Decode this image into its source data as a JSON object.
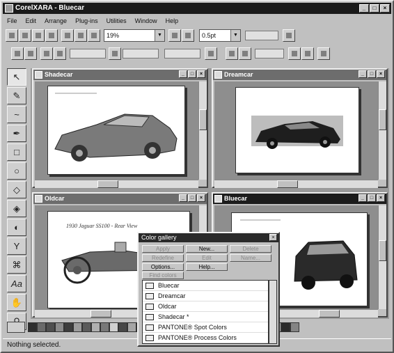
{
  "app": {
    "title": "CorelXARA - Bluecar"
  },
  "menu": [
    "File",
    "Edit",
    "Arrange",
    "Plug-ins",
    "Utilities",
    "Window",
    "Help"
  ],
  "toolbar": {
    "zoom_value": "19%",
    "line_width_value": "0.5pt"
  },
  "windows": [
    {
      "title": "Shadecar",
      "active": false
    },
    {
      "title": "Dreamcar",
      "active": false
    },
    {
      "title": "Oldcar",
      "active": false
    },
    {
      "title": "Bluecar",
      "active": true
    }
  ],
  "oldcar_caption": "1930 Jaguar SS100 - Rear View",
  "dialog": {
    "title": "Color gallery",
    "buttons": [
      "Apply",
      "New...",
      "Delete",
      "Redefine",
      "Edit",
      "Name...",
      "Options...",
      "Help...",
      "Find colors"
    ],
    "items": [
      "Bluecar",
      "Dreamcar",
      "Oldcar",
      "Shadecar *",
      "PANTONE® Spot Colors",
      "PANTONE® Process Colors"
    ]
  },
  "palette": {
    "swatches": [
      "#2e2e2e",
      "#6a6a6a",
      "#4f4f4f",
      "#8a8a8a",
      "#3d3d3d",
      "#9c9c9c",
      "#5b5b5b",
      "#b0b0b0",
      "#787878",
      "#d0d0d0",
      "#474747",
      "#a5a5a5",
      "#656565",
      "#c4c4c4",
      "#353535",
      "#878787",
      "#5e5e5e",
      "#b8b8b8",
      "#424242",
      "#9a9a9a",
      "#707070",
      "#cacaca",
      "#515151",
      "#939393",
      "#3a3a3a",
      "#aeaeae",
      "#676767",
      "#bfbfbf",
      "#2a2a2a",
      "#848484"
    ]
  },
  "status": {
    "text": "Nothing selected."
  }
}
